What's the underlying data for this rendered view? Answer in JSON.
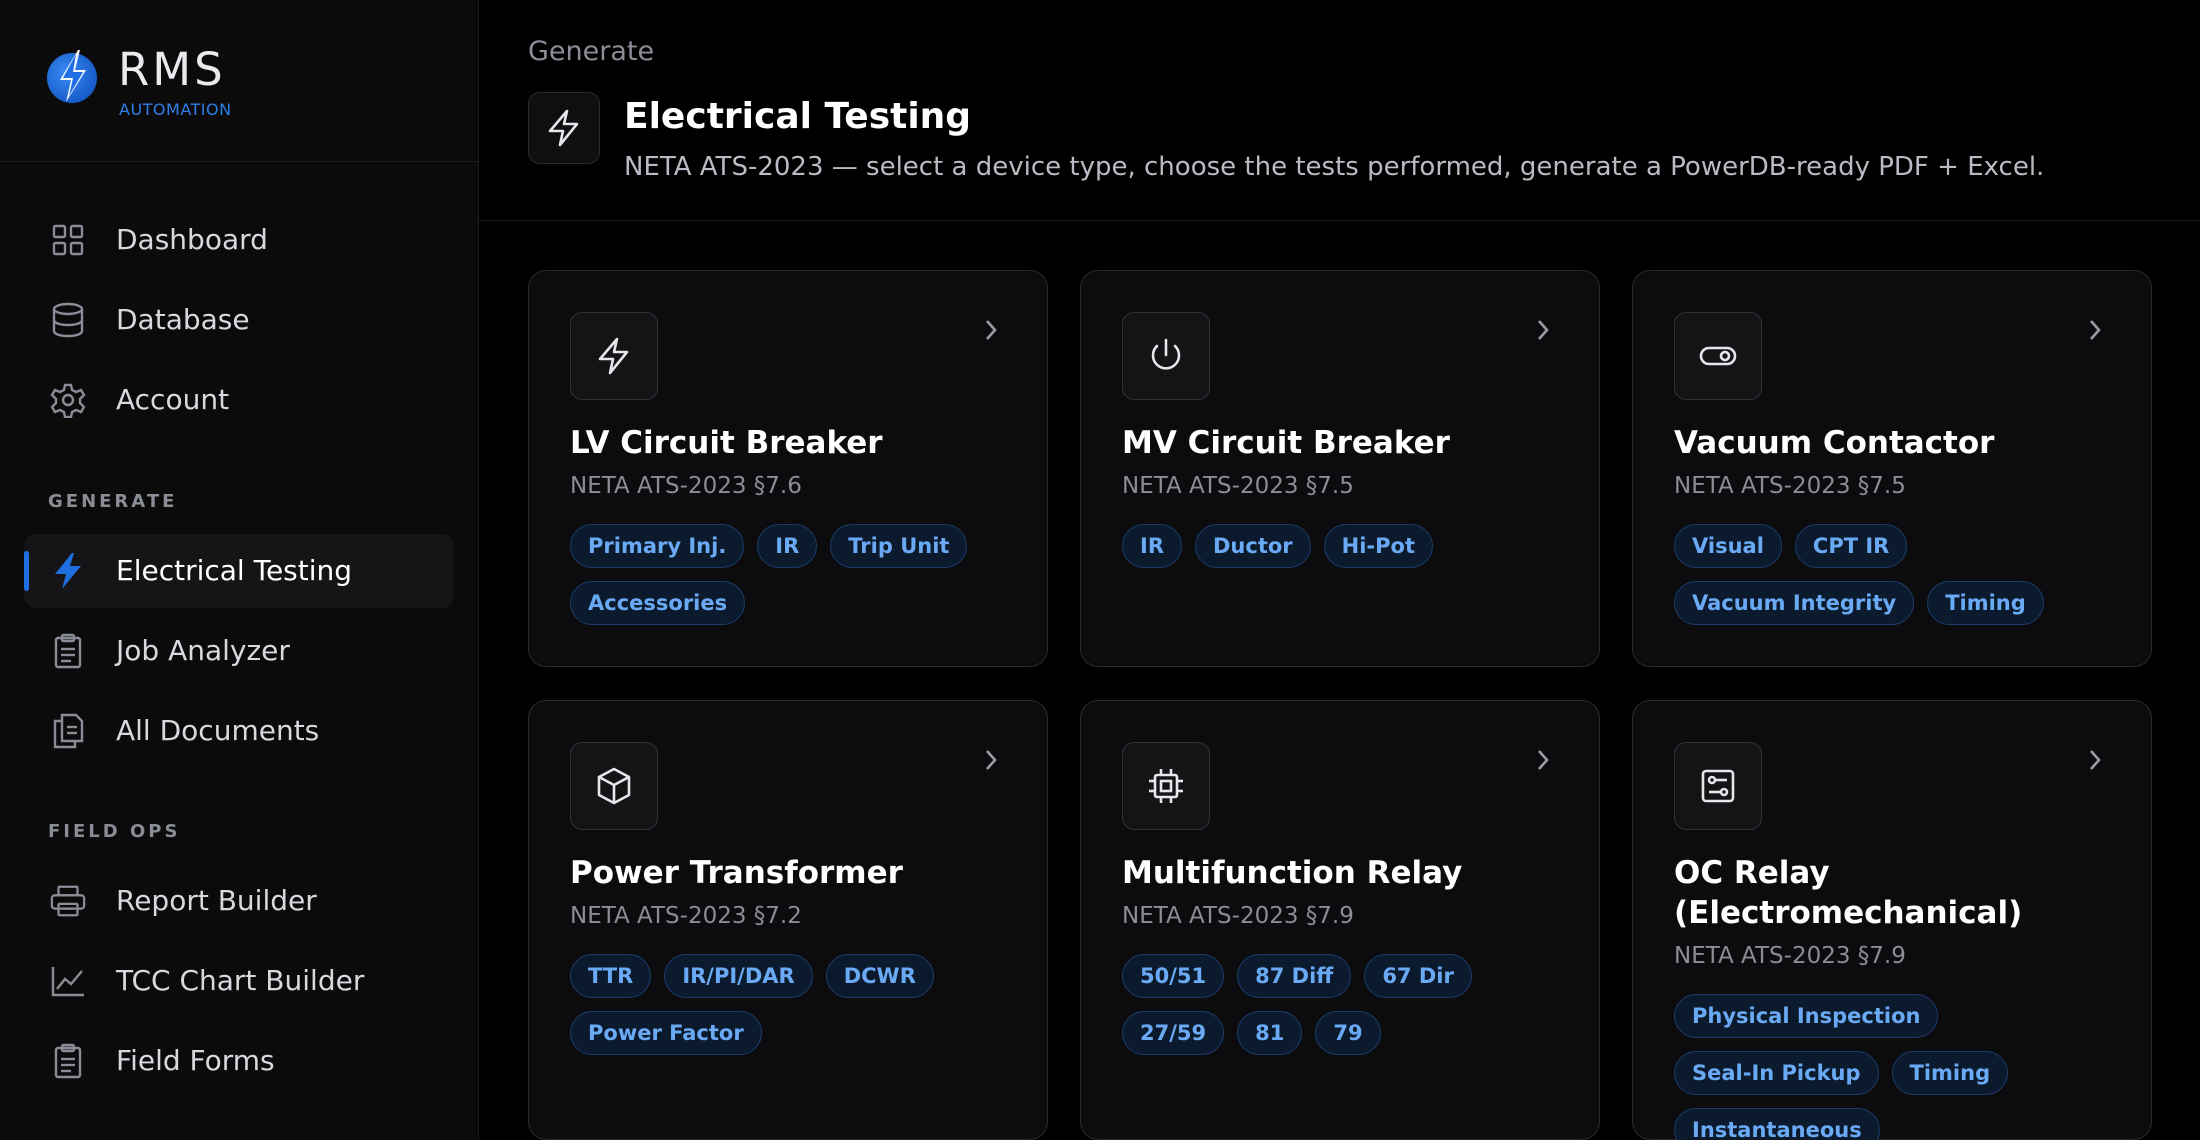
{
  "brand": {
    "name": "RMS",
    "subtitle": "AUTOMATION"
  },
  "sidebar": {
    "items": [
      {
        "label": "Dashboard",
        "icon": "grid-icon"
      },
      {
        "label": "Database",
        "icon": "database-icon"
      },
      {
        "label": "Account",
        "icon": "gear-icon"
      }
    ],
    "sections": [
      {
        "label": "GENERATE",
        "items": [
          {
            "label": "Electrical Testing",
            "icon": "lightning-icon",
            "active": true
          },
          {
            "label": "Job Analyzer",
            "icon": "clipboard-icon"
          },
          {
            "label": "All Documents",
            "icon": "documents-icon"
          }
        ]
      },
      {
        "label": "FIELD OPS",
        "items": [
          {
            "label": "Report Builder",
            "icon": "printer-icon"
          },
          {
            "label": "TCC Chart Builder",
            "icon": "chart-icon"
          },
          {
            "label": "Field Forms",
            "icon": "clipboard-icon"
          }
        ]
      }
    ]
  },
  "header": {
    "breadcrumb": "Generate",
    "title": "Electrical Testing",
    "subtitle": "NETA ATS-2023 — select a device type, choose the tests performed, generate a PowerDB-ready PDF + Excel."
  },
  "cards": [
    {
      "title": "LV Circuit Breaker",
      "standard": "NETA ATS-2023 §7.6",
      "icon": "lightning-icon",
      "tags": [
        "Primary Inj.",
        "IR",
        "Trip Unit",
        "Accessories"
      ]
    },
    {
      "title": "MV Circuit Breaker",
      "standard": "NETA ATS-2023 §7.5",
      "icon": "power-icon",
      "tags": [
        "IR",
        "Ductor",
        "Hi-Pot"
      ]
    },
    {
      "title": "Vacuum Contactor",
      "standard": "NETA ATS-2023 §7.5",
      "icon": "toggle-icon",
      "tags": [
        "Visual",
        "CPT IR",
        "Vacuum Integrity",
        "Timing"
      ]
    },
    {
      "title": "Power Transformer",
      "standard": "NETA ATS-2023 §7.2",
      "icon": "cube-icon",
      "tags": [
        "TTR",
        "IR/PI/DAR",
        "DCWR",
        "Power Factor"
      ]
    },
    {
      "title": "Multifunction Relay",
      "standard": "NETA ATS-2023 §7.9",
      "icon": "cpu-icon",
      "tags": [
        "50/51",
        "87 Diff",
        "67 Dir",
        "27/59",
        "81",
        "79"
      ]
    },
    {
      "title": "OC Relay (Electromechanical)",
      "standard": "NETA ATS-2023 §7.9",
      "icon": "relay-icon",
      "tags": [
        "Physical Inspection",
        "Seal-In Pickup",
        "Timing",
        "Instantaneous"
      ]
    }
  ],
  "colors": {
    "accent": "#1f6fe0",
    "tag_text": "#6aaaf5",
    "tag_bg": "#0c1a2e",
    "background": "#000000",
    "sidebar_bg": "#0b0b0c"
  }
}
